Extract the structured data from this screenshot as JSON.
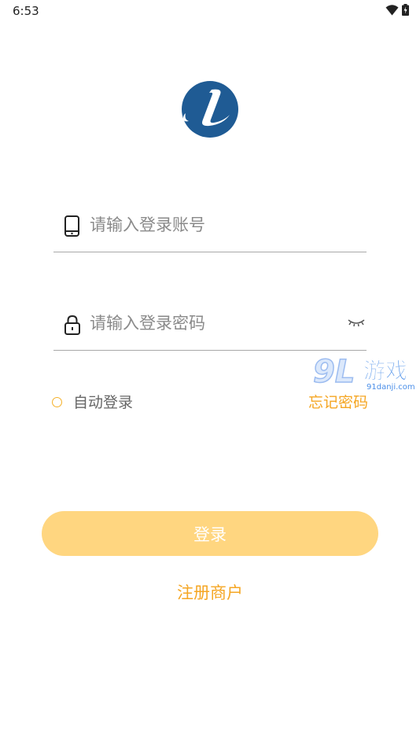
{
  "status_bar": {
    "time": "6:53",
    "icons": [
      "wifi-icon",
      "battery-icon"
    ]
  },
  "logo": {
    "icon": "brand-logo",
    "colors": {
      "primary": "#1f5b94",
      "background": "#ffffff"
    }
  },
  "form": {
    "account": {
      "icon": "phone-icon",
      "placeholder": "请输入登录账号",
      "value": ""
    },
    "password": {
      "icon": "lock-icon",
      "placeholder": "请输入登录密码",
      "value": "",
      "toggle_icon": "eye-closed-icon"
    }
  },
  "options": {
    "auto_login_label": "自动登录",
    "auto_login_checked": false,
    "forgot_password_label": "忘记密码"
  },
  "actions": {
    "login_label": "登录",
    "register_label": "注册商户"
  },
  "watermark": {
    "logo_text": "9L",
    "title": "游戏",
    "url": "91danji.com"
  },
  "colors": {
    "accent": "#f5a623",
    "button_bg": "#ffd680",
    "divider": "#a8a8a8",
    "placeholder": "#8a8a8a",
    "logo_blue": "#1f5b94"
  }
}
